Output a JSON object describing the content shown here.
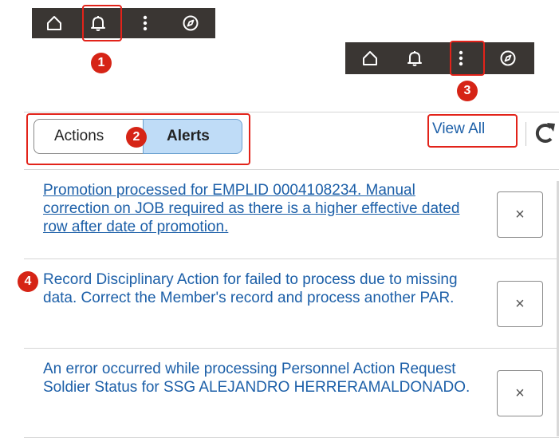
{
  "toolbar_top": {
    "icons": [
      "home-icon",
      "bell-icon",
      "more-vertical-icon",
      "compass-icon"
    ],
    "highlight": "bell-icon"
  },
  "toolbar_second": {
    "icons": [
      "home-icon",
      "bell-icon",
      "more-vertical-icon",
      "compass-icon"
    ],
    "highlight": "more-vertical-icon"
  },
  "callouts": {
    "one": "1",
    "two": "2",
    "three": "3",
    "four": "4"
  },
  "panel": {
    "tabs": {
      "actions": "Actions",
      "alerts": "Alerts",
      "selected": "Alerts"
    },
    "view_all": "View All",
    "alerts": [
      {
        "text": "Promotion processed for EMPLID 0004108234. Manual correction on JOB required as there is a higher effective dated row after date of promotion.",
        "dismiss": "×"
      },
      {
        "text": "Record Disciplinary Action for failed to process due to missing data. Correct the Member's record and process another PAR.",
        "dismiss": "×"
      },
      {
        "text": "An error occurred while processing Personnel Action Request Soldier Status for SSG ALEJANDRO HERRERAMALDONADO.",
        "dismiss": "×"
      }
    ]
  },
  "colors": {
    "toolbar_bg": "#3a3633",
    "highlight_red": "#e2231a",
    "badge_red": "#d62416",
    "link_blue": "#1c5fa8",
    "selected_tab_bg": "#bfdcf7"
  }
}
